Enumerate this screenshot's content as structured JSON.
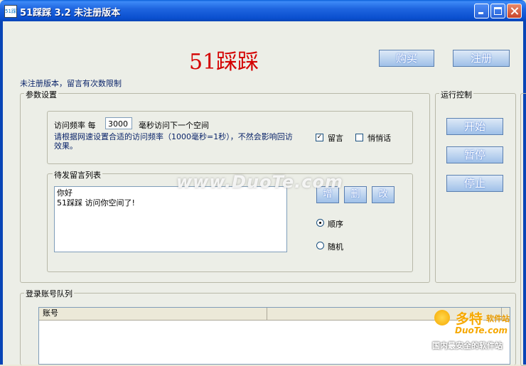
{
  "window": {
    "title": "51踩踩  3.2  未注册版本",
    "app_icon_text": "51踩"
  },
  "header": {
    "big_title": "51踩踩",
    "buy_label": "购买",
    "register_label": "注册",
    "unregistered_note": "未注册版本，留言有次数限制"
  },
  "params": {
    "group_label": "参数设置",
    "freq_prefix": "访问频率 每",
    "freq_value": "3000",
    "freq_suffix": "毫秒访问下一个空间",
    "freq_hint": "请根据网速设置合适的访问频率（1000毫秒=1秒），不然会影响回访效果。",
    "leave_message_label": "留言",
    "leave_message_checked": true,
    "whisper_label": "悄悄话",
    "whisper_checked": false
  },
  "messages": {
    "group_label": "待发留言列表",
    "lines": [
      "你好",
      "51踩踩 访问你空间了!"
    ],
    "add_label": "增",
    "delete_label": "删",
    "edit_label": "改",
    "order_label": "顺序",
    "random_label": "随机",
    "selected_mode": "order"
  },
  "run": {
    "group_label": "运行控制",
    "start_label": "开始",
    "pause_label": "暂停",
    "stop_label": "停止"
  },
  "accounts": {
    "group_label": "登录账号队列",
    "columns": [
      "账号",
      ""
    ]
  },
  "watermark": {
    "center": "www.DuoTe.com",
    "brand": "多特",
    "brand_sub": "软件站",
    "domain": "DuoTe.com",
    "slogan": "国内最安全的软件站"
  }
}
